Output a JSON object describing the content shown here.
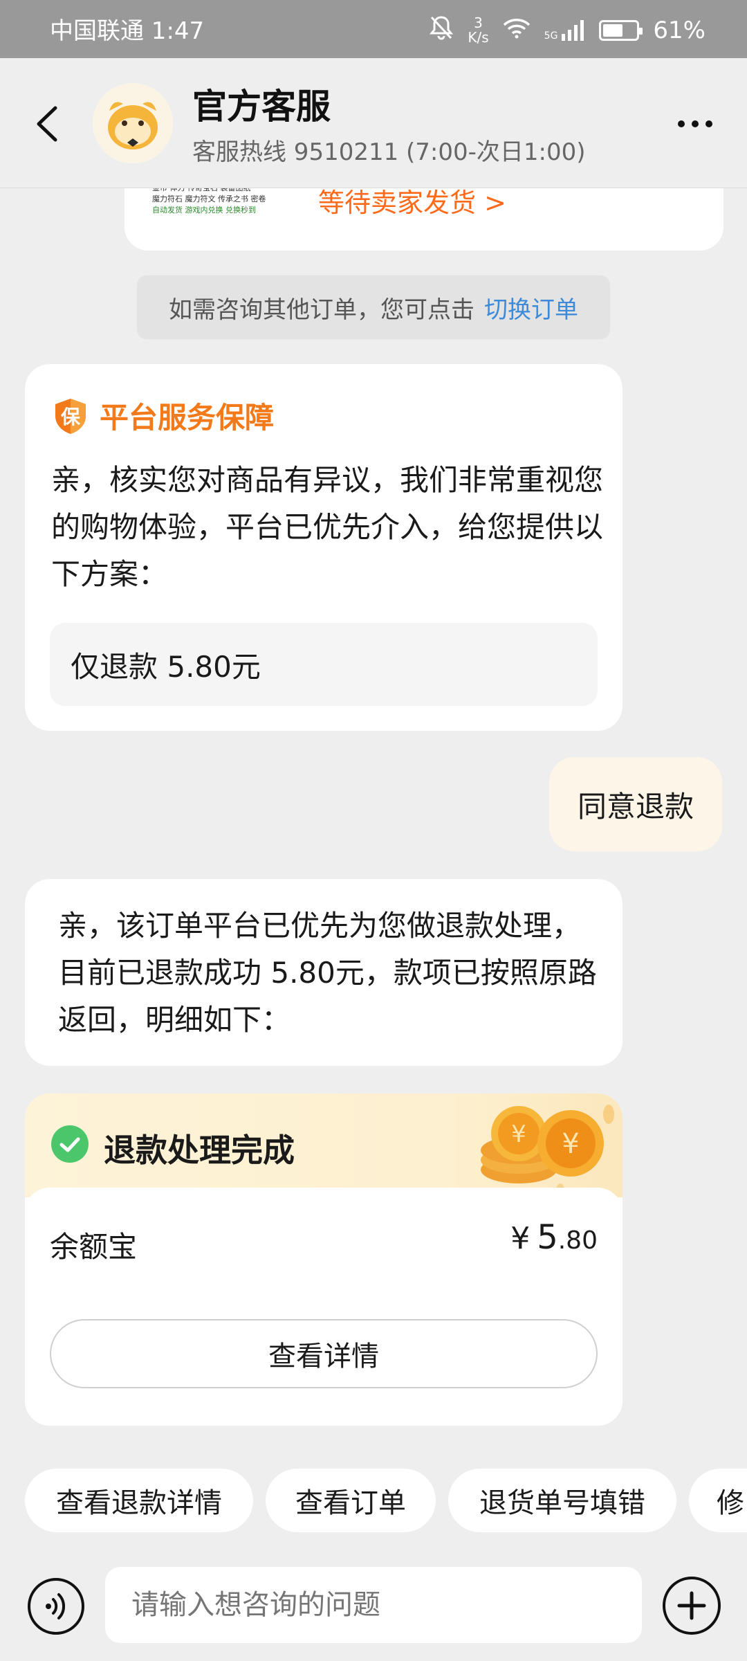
{
  "status_bar": {
    "carrier_time": "中国联通 1:47",
    "speed_top": "3",
    "speed_unit": "K/s",
    "signal": "5G",
    "battery": "61%"
  },
  "header": {
    "title": "官方客服",
    "subtitle": "客服热线 9510211 (7:00-次日1:00)"
  },
  "order_card": {
    "thumb_line_1": "金币 体力 传奇宝石 装备图纸",
    "thumb_line_2": "魔力符石 魔力符文 传承之书 密卷",
    "thumb_line_3": "自动发货 游戏内兑换 兑换秒到",
    "status": "等待卖家发货 >"
  },
  "notice": {
    "text": "如需咨询其他订单，您可点击",
    "link": "切换订单"
  },
  "bubble_1": {
    "badge": "保",
    "guarantee": "平台服务保障",
    "text": "亲，核实您对商品有异议，我们非常重视您的购物体验，平台已优先介入，给您提供以下方案：",
    "option": "仅退款 5.80元"
  },
  "user_reply": "同意退款",
  "bubble_2": {
    "text": "亲，该订单平台已优先为您做退款处理，目前已退款成功 5.80元，款项已按照原路返回，明细如下："
  },
  "result_card": {
    "title": "退款处理完成",
    "wallet": "余额宝",
    "currency": "¥",
    "amount_int": "5",
    "amount_dec": ".80",
    "detail_button": "查看详情"
  },
  "quick_replies": [
    "查看退款详情",
    "查看订单",
    "退货单号填错",
    "修"
  ],
  "input": {
    "placeholder": "请输入想咨询的问题"
  },
  "colors": {
    "accent_orange": "#f27a1a",
    "link_blue": "#3d8bd8",
    "check_green": "#4cc66a"
  }
}
